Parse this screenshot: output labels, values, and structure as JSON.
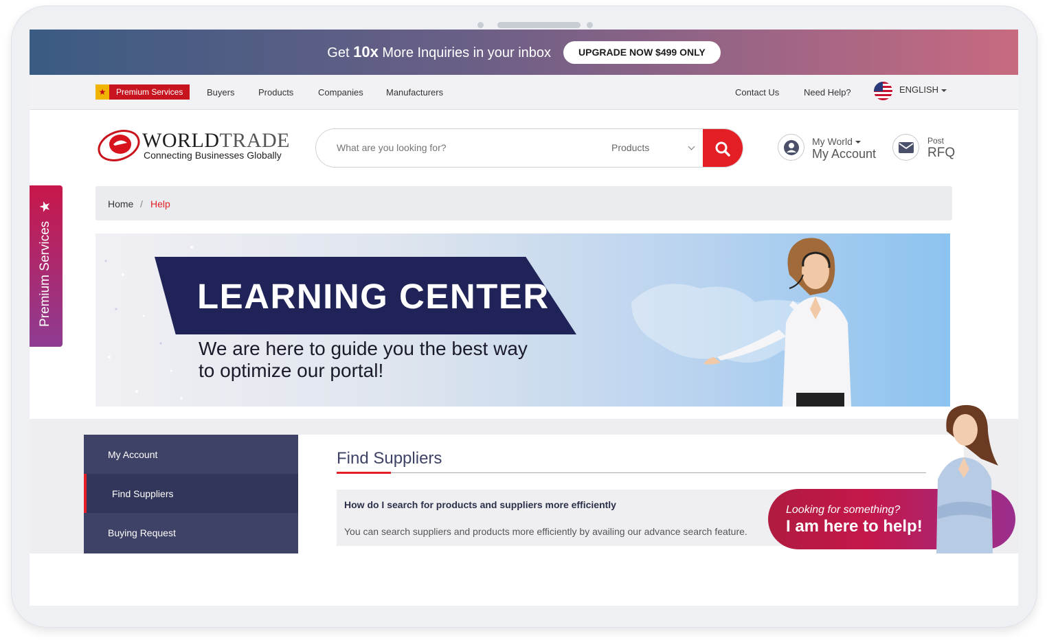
{
  "promo": {
    "text_before": "Get ",
    "text_bold": "10x",
    "text_after": " More Inquiries in your inbox",
    "button": "UPGRADE NOW $499 ONLY"
  },
  "nav": {
    "premium": "Premium Services",
    "items": [
      "Buyers",
      "Products",
      "Companies",
      "Manufacturers"
    ],
    "right_items": [
      "Contact Us",
      "Need Help?"
    ],
    "language": "ENGLISH"
  },
  "logo": {
    "name_a": "WORLD",
    "name_b": "TRADE",
    "tagline": "Connecting Businesses Globally"
  },
  "search": {
    "placeholder": "What are you looking for?",
    "category": "Products"
  },
  "account": {
    "small": "My World",
    "big": "My Account"
  },
  "rfq": {
    "small": "Post",
    "big": "RFQ"
  },
  "side_tab": "Premium Services",
  "breadcrumb": {
    "home": "Home",
    "sep": "/",
    "current": "Help"
  },
  "banner": {
    "title": "LEARNING CENTER",
    "sub1": "We are here to guide you the best way",
    "sub2": "to optimize our portal!"
  },
  "menu": [
    "My Account",
    "Find Suppliers",
    "Buying Request"
  ],
  "content": {
    "title": "Find Suppliers",
    "question": "How do I search for products and suppliers more efficiently",
    "answer": "You can search suppliers and products more efficiently by availing our advance search feature."
  },
  "help": {
    "small": "Looking for something?",
    "big": "I am here to help!"
  },
  "colors": {
    "accent_red": "#e31e24",
    "navy": "#3e4266",
    "banner_ribbon": "#1f2358"
  }
}
